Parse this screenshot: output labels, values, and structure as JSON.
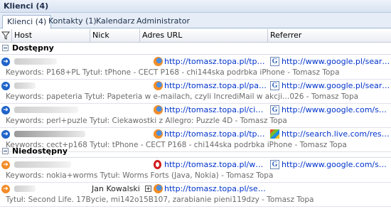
{
  "window": {
    "title": "Klienci (4)"
  },
  "tabs": [
    {
      "label": "Klienci (4)",
      "active": true
    },
    {
      "label": "Kontakty (1)",
      "active": false
    },
    {
      "label": "Kalendarz",
      "active": false
    },
    {
      "label": "Administrator",
      "active": false
    }
  ],
  "columns": {
    "host": "Host",
    "nick": "Nick",
    "url": "Adres URL",
    "referrer": "Referrer"
  },
  "groups": {
    "available": "Dostępny",
    "unavailable": "Niedostępny"
  },
  "rows": [
    {
      "status": "online",
      "nick": "",
      "browser": "firefox",
      "url": "http://tomasz.topa.pl/tphone-c...",
      "ref_icon": "google",
      "referrer": "http://www.google.pl/search?hl=pl...",
      "detail": "Keywords: P168+PL Tytuł: tPhone - CECT P168 - chi144ska podrbka iPhone - Tomasz Topa"
    },
    {
      "status": "online",
      "nick": "",
      "browser": "firefox",
      "url": "http://tomasz.topa.pl/papeteri...",
      "ref_icon": "google",
      "referrer": "http://www.google.pl/search?hl=pl...",
      "detail": "Keywords: papeteria Tytuł: Papeteria w e-mailach, czyli IncrediMail w akcji…026 - Tomasz Topa"
    },
    {
      "status": "online",
      "nick": "",
      "browser": "firefox",
      "url": "http://tomasz.topa.pl/ciekawos...",
      "ref_icon": "google",
      "referrer": "http://www.google.com/search?hl...",
      "detail": "Keywords: perl+puzle Tytuł: Ciekawostki z Allegro: Puzzle 4D - Tomasz Topa"
    },
    {
      "status": "online",
      "nick": "",
      "browser": "firefox",
      "url": "http://tomasz.topa.pl/tphone-c...",
      "ref_icon": "live",
      "referrer": "http://search.live.com/results.asp...",
      "detail": "Keywords: cect+p168 Tytuł: tPhone - CECT P168 - chi144ska podrbka iPhone - Tomasz Topa"
    },
    {
      "status": "offline",
      "nick": "",
      "browser": "opera",
      "url": "http://tomasz.topa.pl/worms-f...",
      "ref_icon": "google",
      "referrer": "http://www.google.com/search?hl...",
      "detail": "Keywords: nokia+worms Tytuł:  Worms Forts (Java, Nokia) - Tomasz Topa"
    },
    {
      "status": "offline",
      "nick": "Jan Kowalski",
      "browser": "firefox",
      "url": "http://tomasz.topa.pl/second-li...",
      "ref_icon": "",
      "referrer": "",
      "detail": "Tytuł: Second Life. 17Bycie, mi142o15B107, zarabianie pieni119dzy - Tomasz Topa"
    }
  ]
}
